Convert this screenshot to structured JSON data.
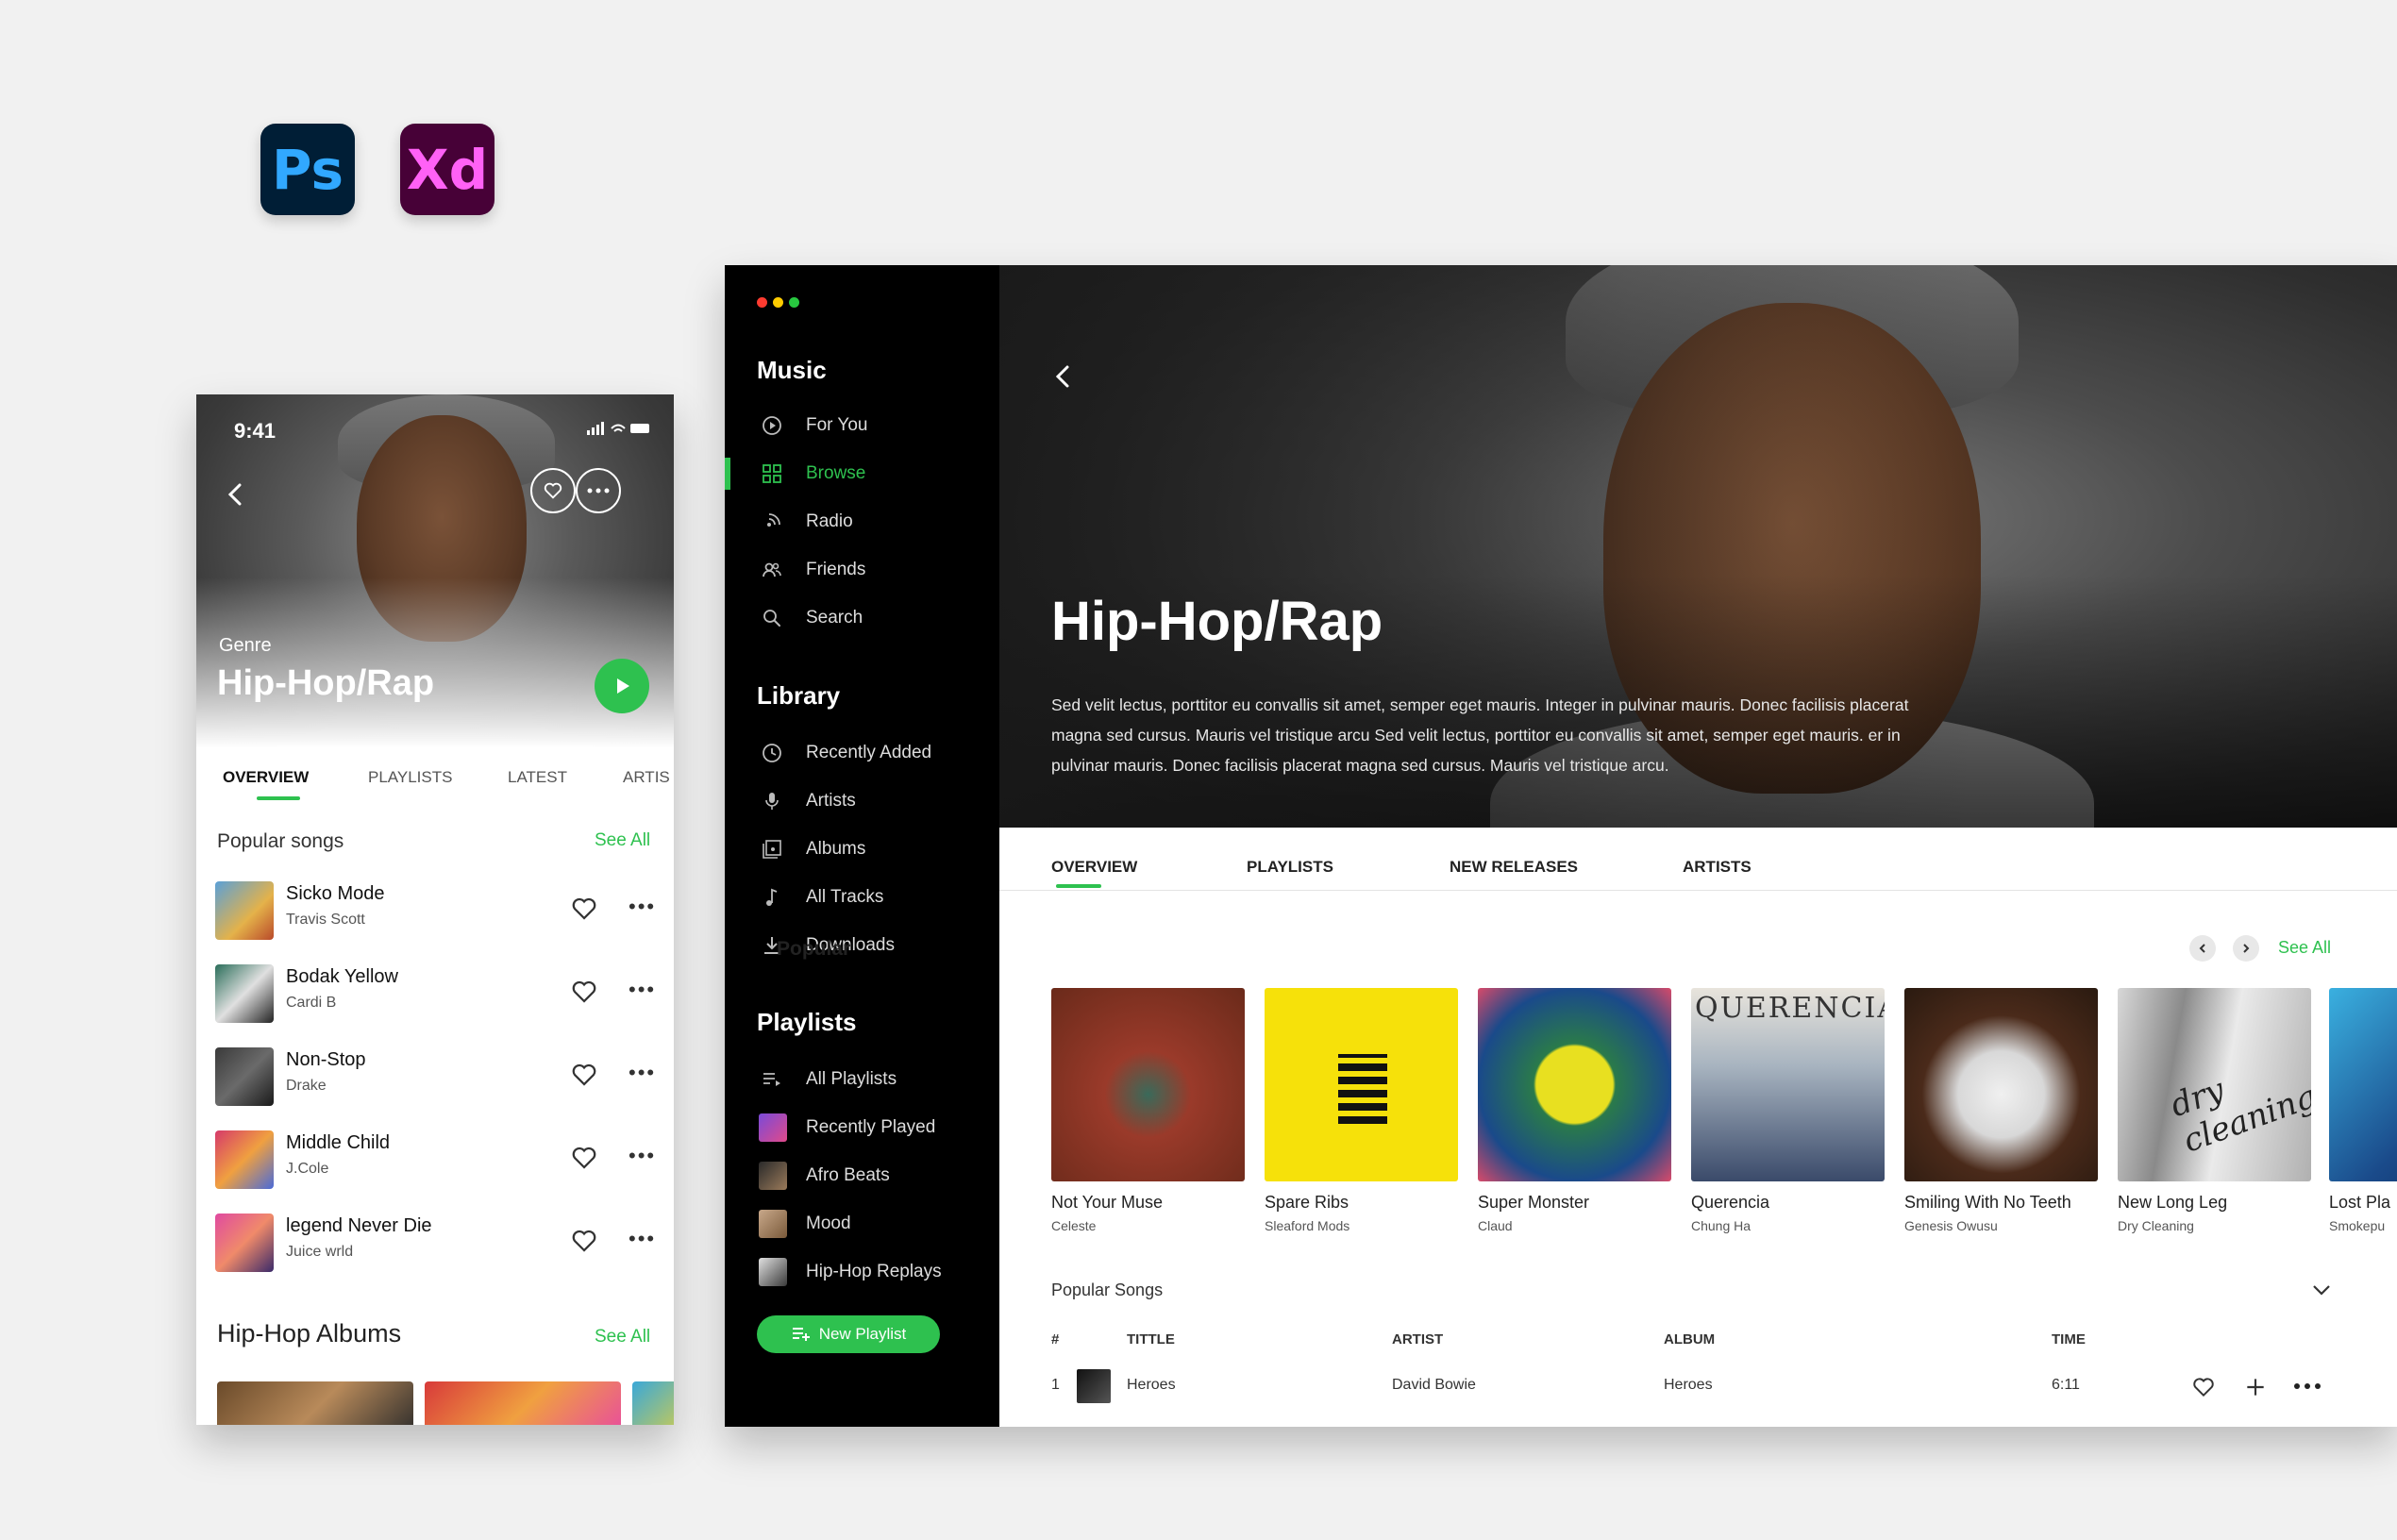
{
  "badges": {
    "ps": "Ps",
    "xd": "Xd"
  },
  "mobile": {
    "time": "9:41",
    "genre_label": "Genre",
    "title": "Hip-Hop/Rap",
    "tabs": [
      "OVERVIEW",
      "PLAYLISTS",
      "LATEST",
      "ARTIS"
    ],
    "popular_songs_label": "Popular songs",
    "see_all": "See All",
    "songs": [
      {
        "name": "Sicko Mode",
        "artist": "Travis Scott"
      },
      {
        "name": "Bodak Yellow",
        "artist": "Cardi B"
      },
      {
        "name": "Non-Stop",
        "artist": "Drake"
      },
      {
        "name": "Middle Child",
        "artist": "J.Cole"
      },
      {
        "name": "legend Never Die",
        "artist": "Juice wrld"
      }
    ],
    "albums_label": "Hip-Hop Albums",
    "albums_see_all": "See All"
  },
  "desktop": {
    "sidebar": {
      "music_heading": "Music",
      "music_items": [
        "For You",
        "Browse",
        "Radio",
        "Friends",
        "Search"
      ],
      "active_item": "Browse",
      "library_heading": "Library",
      "library_items": [
        "Recently Added",
        "Artists",
        "Albums",
        "All Tracks",
        "Downloads"
      ],
      "playlists_heading": "Playlists",
      "playlist_items": [
        "All Playlists",
        "Recently Played",
        "Afro Beats",
        "Mood",
        "Hip-Hop Replays"
      ],
      "new_playlist_button": "New Playlist"
    },
    "hero": {
      "title": "Hip-Hop/Rap",
      "description": "Sed velit lectus, porttitor eu convallis sit amet, semper eget mauris. Integer in pulvinar mauris. Donec facilisis placerat magna sed cursus. Mauris vel tristique arcu Sed velit lectus, porttitor eu convallis sit amet, semper eget mauris. er in pulvinar mauris. Donec facilisis placerat magna sed cursus. Mauris vel tristique arcu."
    },
    "tabs": [
      "OVERVIEW",
      "PLAYLISTS",
      "NEW RELEASES",
      "ARTISTS"
    ],
    "popular_label": "Popular",
    "see_all": "See All",
    "albums": [
      {
        "name": "Not Your Muse",
        "artist": "Celeste"
      },
      {
        "name": "Spare Ribs",
        "artist": "Sleaford Mods"
      },
      {
        "name": "Super Monster",
        "artist": "Claud"
      },
      {
        "name": "Querencia",
        "artist": "Chung Ha"
      },
      {
        "name": "Smiling With No Teeth",
        "artist": "Genesis Owusu"
      },
      {
        "name": "New Long Leg",
        "artist": "Dry Cleaning"
      },
      {
        "name": "Lost Pla",
        "artist": "Smokepu"
      }
    ],
    "album_cover_text": {
      "querencia": "QUERENCIA",
      "dry_cleaning": "dry cleaning"
    },
    "popular_songs_label": "Popular Songs",
    "table_headers": {
      "num": "#",
      "title": "TITTLE",
      "artist": "ARTIST",
      "album": "ALBUM",
      "time": "TIME"
    },
    "table_rows": [
      {
        "num": "1",
        "title": "Heroes",
        "artist": "David Bowie",
        "album": "Heroes",
        "time": "6:11"
      }
    ]
  },
  "colors": {
    "accent": "#2ec14f",
    "sidebar": "#000000",
    "mac_red": "#ff3b30",
    "mac_yellow": "#ffcc00",
    "mac_green": "#28c840"
  }
}
